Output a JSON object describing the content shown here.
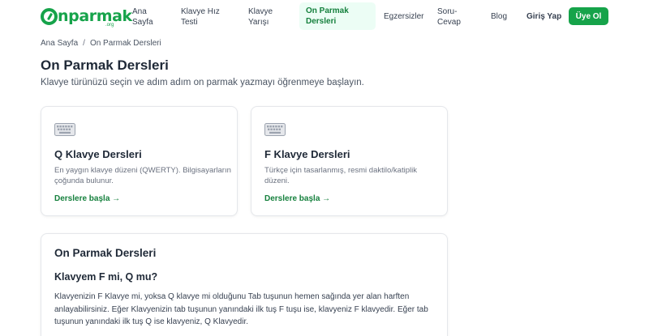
{
  "brand": {
    "logo_text": "nparmak",
    "logo_suffix": ".org",
    "color": "#16a34a"
  },
  "nav": {
    "items": [
      {
        "label_line1": "Ana",
        "label_line2": "Sayfa"
      },
      {
        "label_line1": "Klavye Hız",
        "label_line2": "Testi"
      },
      {
        "label_line1": "Klavye",
        "label_line2": "Yarışı"
      },
      {
        "label_line1": "On Parmak",
        "label_line2": "Dersleri"
      },
      {
        "label_line1": "Egzersizler"
      },
      {
        "label_line1": "Soru-",
        "label_line2": "Cevap"
      },
      {
        "label_line1": "Blog"
      }
    ],
    "login_label": "Giriş Yap",
    "signup_label": "Üye Ol",
    "active_index": 3
  },
  "breadcrumb": {
    "home": "Ana Sayfa",
    "separator": "/",
    "current": "On Parmak Dersleri"
  },
  "page": {
    "title": "On Parmak Dersleri",
    "subtitle": "Klavye türünüzü seçin ve adım adım on parmak yazmayı öğrenmeye başlayın."
  },
  "cards": [
    {
      "icon": "keyboard-icon",
      "title": "Q Klavye Dersleri",
      "desc": "En yaygın klavye düzeni (QWERTY). Bilgisayarların çoğunda bulunur.",
      "link": "Derslere başla →"
    },
    {
      "icon": "keyboard-icon",
      "title": "F Klavye Dersleri",
      "desc": "Türkçe için tasarlanmış, resmi daktilo/katiplik düzeni.",
      "link": "Derslere başla →"
    }
  ],
  "info": {
    "title": "On Parmak Dersleri",
    "heading": "Klavyem F mi, Q mu?",
    "text": "Klavyenizin F Klavye mi, yoksa Q klavye mi olduğunu Tab tuşunun hemen sağında yer alan harften anlayabilirsiniz. Eğer Klavyenizin tab tuşunun yanındaki ilk tuş F tuşu ise, klavyeniz F klavyedir. Eğer tab tuşunun yanındaki ilk tuş Q ise klavyeniz, Q Klavyedir."
  }
}
